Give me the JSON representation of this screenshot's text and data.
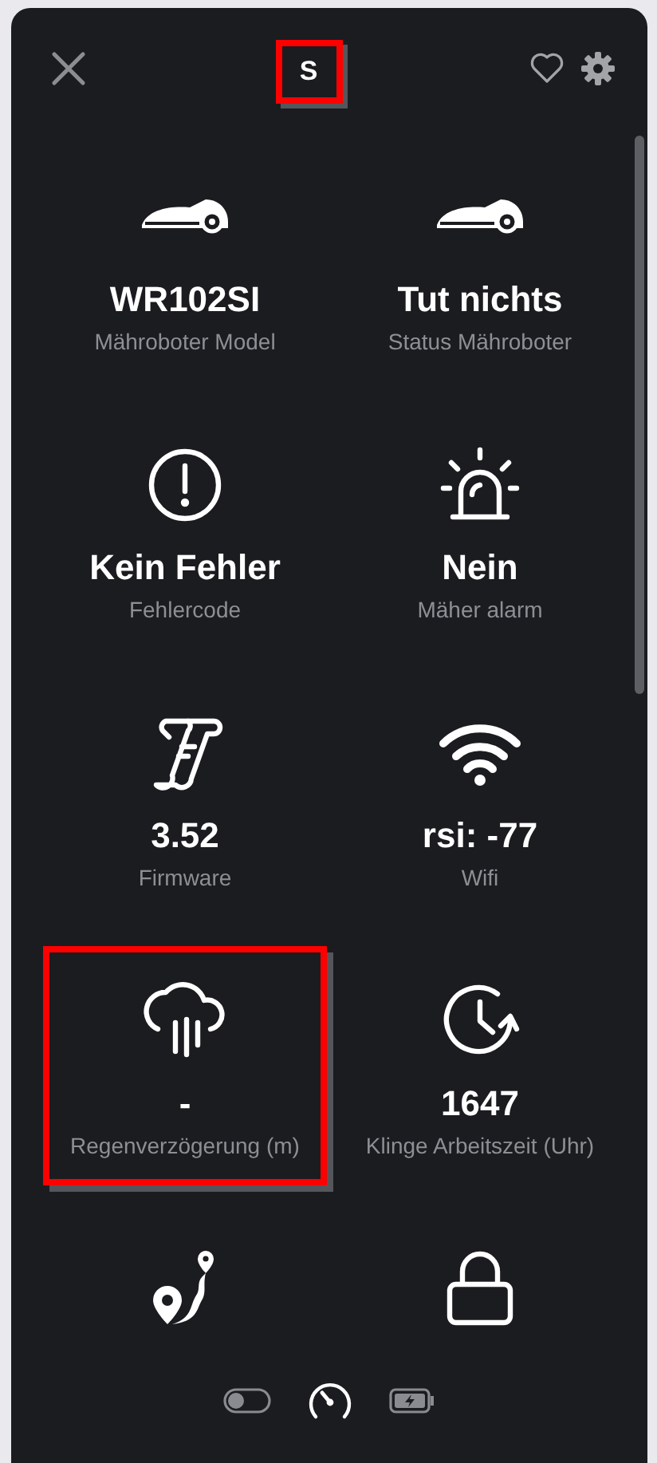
{
  "header": {
    "badge": {
      "text": "S",
      "highlighted": true
    }
  },
  "tile_rows": [
    {
      "tiles": [
        {
          "value": "WR102SI",
          "label": "Mähroboter Model",
          "highlighted": false
        },
        {
          "value": "Tut nichts",
          "label": "Status Mähroboter",
          "highlighted": false
        }
      ]
    },
    {
      "tiles": [
        {
          "value": "Kein Fehler",
          "label": "Fehlercode",
          "highlighted": false
        },
        {
          "value": "Nein",
          "label": "Mäher alarm",
          "highlighted": false
        }
      ]
    },
    {
      "tiles": [
        {
          "value": "3.52",
          "label": "Firmware",
          "highlighted": false
        },
        {
          "value": "rsi: -77",
          "label": "Wifi",
          "highlighted": false
        }
      ]
    },
    {
      "tiles": [
        {
          "value": "-",
          "label": "Regenverzögerung (m)",
          "highlighted": true
        },
        {
          "value": "1647",
          "label": "Klinge Arbeitszeit (Uhr)",
          "highlighted": false
        }
      ]
    },
    {
      "tiles": [
        {
          "highlighted": false
        },
        {
          "highlighted": false
        }
      ]
    }
  ],
  "bottom_nav": [
    {
      "selected": false
    },
    {
      "selected": true
    },
    {
      "selected": false
    }
  ]
}
